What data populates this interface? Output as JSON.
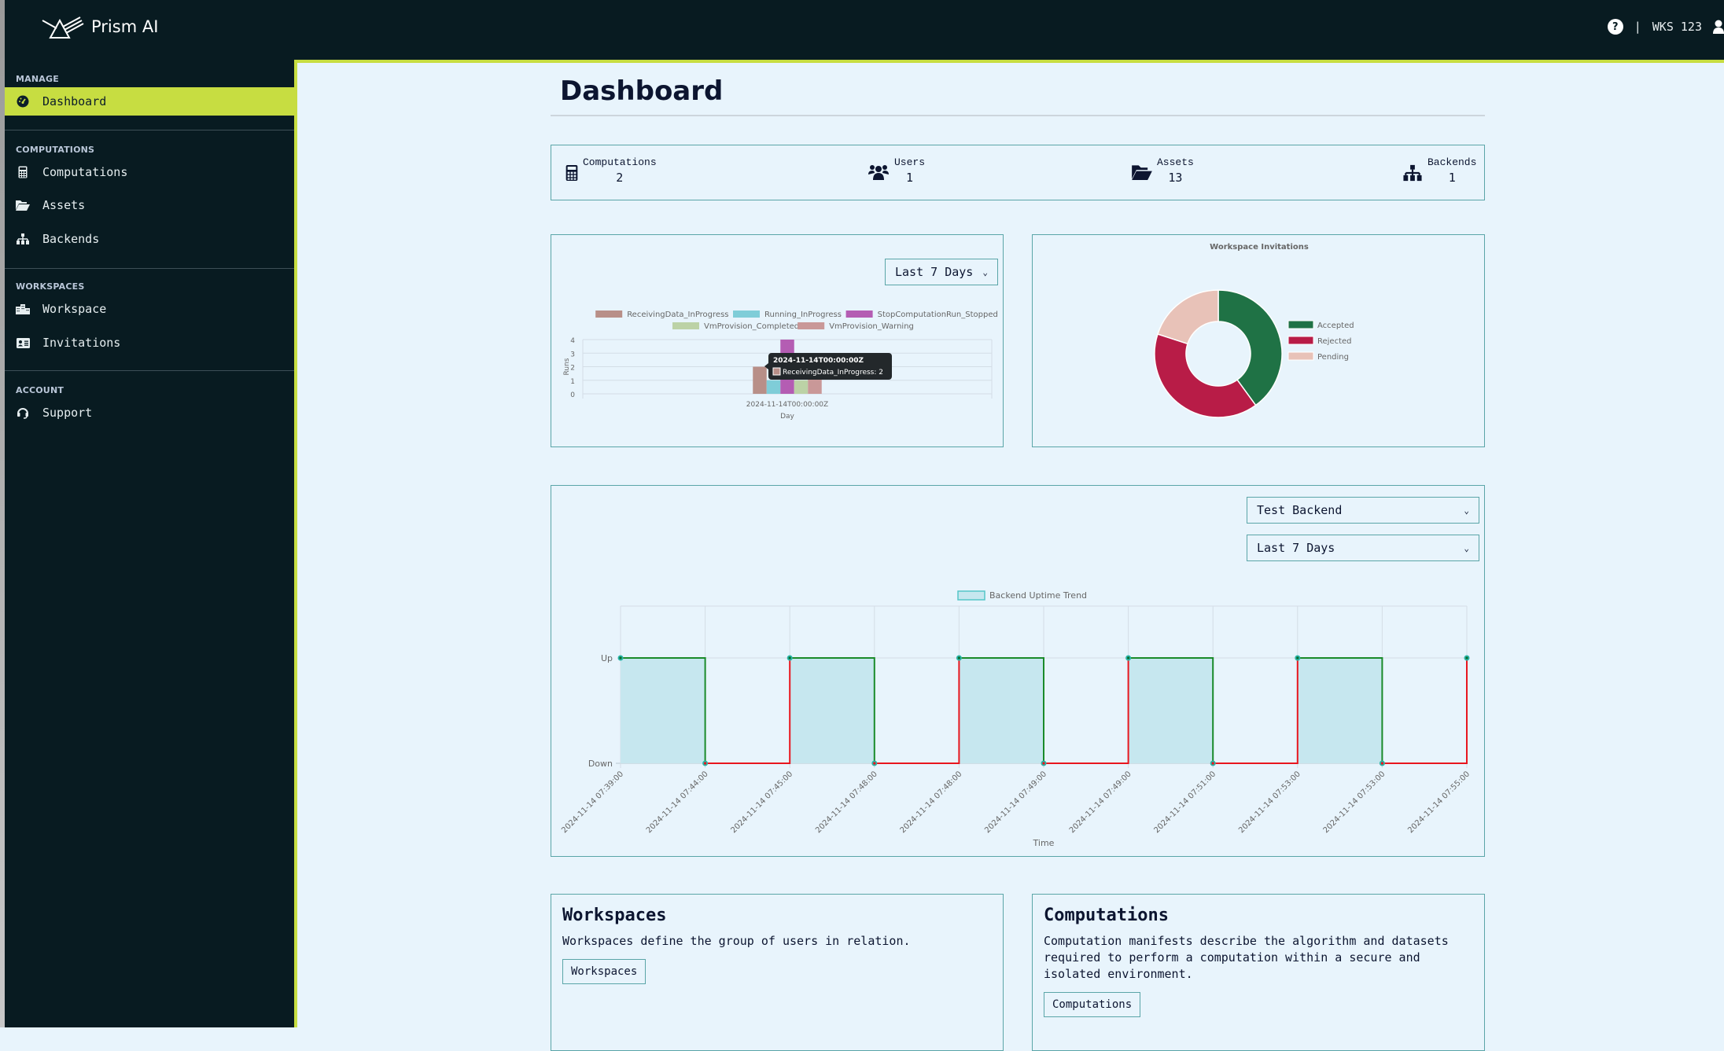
{
  "app": {
    "name": "Prism AI"
  },
  "topbar": {
    "help_icon": "question-circle-icon",
    "separator": "|",
    "workspace": "WKS 123",
    "user_icon": "user-icon"
  },
  "sidebar": {
    "sections": [
      {
        "title": "MANAGE",
        "items": [
          {
            "label": "Dashboard",
            "icon": "dashboard-gauge-icon",
            "active": true
          }
        ]
      },
      {
        "title": "COMPUTATIONS",
        "items": [
          {
            "label": "Computations",
            "icon": "calculator-icon"
          },
          {
            "label": "Assets",
            "icon": "folder-open-icon"
          },
          {
            "label": "Backends",
            "icon": "sitemap-icon"
          }
        ]
      },
      {
        "title": "WORKSPACES",
        "items": [
          {
            "label": "Workspace",
            "icon": "building-icon"
          },
          {
            "label": "Invitations",
            "icon": "id-card-icon"
          }
        ]
      },
      {
        "title": "ACCOUNT",
        "items": [
          {
            "label": "Support",
            "icon": "headset-icon"
          }
        ]
      }
    ]
  },
  "page": {
    "title": "Dashboard"
  },
  "stats": [
    {
      "label": "Computations",
      "value": "2",
      "icon": "calculator-icon"
    },
    {
      "label": "Users",
      "value": "1",
      "icon": "users-icon"
    },
    {
      "label": "Assets",
      "value": "13",
      "icon": "folder-open-icon"
    },
    {
      "label": "Backends",
      "value": "1",
      "icon": "sitemap-icon"
    }
  ],
  "runs_panel": {
    "range_select": "Last 7 Days"
  },
  "uptime_panel": {
    "backend_select": "Test Backend",
    "range_select": "Last 7 Days"
  },
  "chart_data": [
    {
      "type": "bar",
      "title": "",
      "xlabel": "Day",
      "ylabel": "Runs",
      "ylim": [
        0,
        4
      ],
      "yticks": [
        0,
        1,
        2,
        3,
        4
      ],
      "categories": [
        "2024-11-14T00:00:00Z"
      ],
      "legend_position": "top",
      "series": [
        {
          "name": "ReceivingData_InProgress",
          "color": "#b88f88",
          "values": [
            2
          ]
        },
        {
          "name": "Running_InProgress",
          "color": "#7fcdd8",
          "values": [
            1
          ]
        },
        {
          "name": "StopComputationRun_Stopped",
          "color": "#b45db3",
          "values": [
            4
          ]
        },
        {
          "name": "VmProvision_Completed",
          "color": "#bcd2a6",
          "values": [
            1
          ]
        },
        {
          "name": "VmProvision_Warning",
          "color": "#c99898",
          "values": [
            2
          ]
        }
      ],
      "tooltip": {
        "title": "2024-11-14T00:00:00Z",
        "line": "ReceivingData_InProgress: 2"
      }
    },
    {
      "type": "pie",
      "title": "Workspace Invitations",
      "donut": true,
      "legend_position": "right",
      "labels": [
        "Accepted",
        "Rejected",
        "Pending"
      ],
      "values": [
        2,
        2,
        1
      ],
      "colors": [
        "#1f7245",
        "#b81c47",
        "#e8c2b8"
      ]
    },
    {
      "type": "line",
      "stepped": true,
      "title": "",
      "legend": [
        "Backend Uptime Trend"
      ],
      "legend_position": "top",
      "xlabel": "Time",
      "ylabel": "",
      "ytick_labels": [
        "Down",
        "Up"
      ],
      "x": [
        "2024-11-14 07:39:00",
        "2024-11-14 07:44:00",
        "2024-11-14 07:45:00",
        "2024-11-14 07:48:00",
        "2024-11-14 07:48:00",
        "2024-11-14 07:49:00",
        "2024-11-14 07:49:00",
        "2024-11-14 07:51:00",
        "2024-11-14 07:53:00",
        "2024-11-14 07:53:00",
        "2024-11-14 07:55:00"
      ],
      "values": [
        1,
        0,
        1,
        0,
        1,
        0,
        1,
        0,
        1,
        0,
        1
      ],
      "colors": {
        "up_line": "#1a8a2a",
        "down_line": "#e8161e",
        "fill": "#c6e7ef",
        "point": "#2bb5a8"
      }
    }
  ],
  "cards": [
    {
      "title": "Workspaces",
      "description": "Workspaces define the group of users in relation.",
      "button": "Workspaces"
    },
    {
      "title": "Computations",
      "description": "Computation manifests describe the algorithm and datasets required to perform a computation within a secure and isolated environment.",
      "button": "Computations"
    }
  ]
}
